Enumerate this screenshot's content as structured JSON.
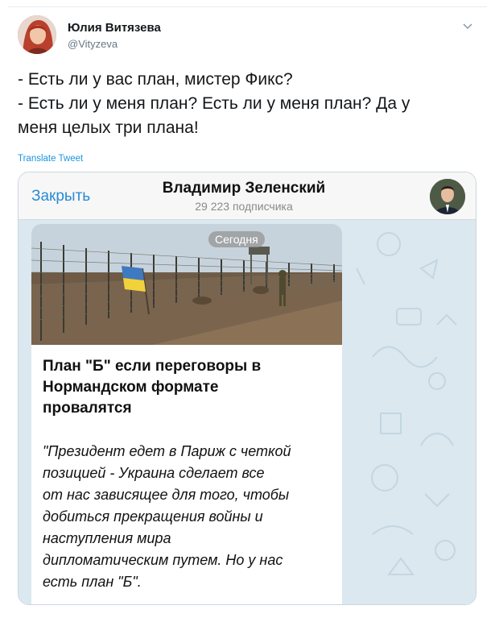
{
  "tweet": {
    "author_name": "Юлия Витязева",
    "author_handle": "@Vityzeva",
    "text": "- Есть ли у вас план, мистер Фикс?\n- Есть ли у меня план? Есть ли у меня план? Да у\nменя целых три плана!",
    "translate_label": "Translate Tweet",
    "colors": {
      "link": "#1b95e0",
      "text": "#14171a",
      "secondary": "#657786"
    }
  },
  "telegram": {
    "close_label": "Закрыть",
    "channel_name": "Владимир Зеленский",
    "subscribers": "29 223 подписчика",
    "date_badge": "Сегодня",
    "post_title": "План \"Б\" если переговоры в\nНормандском формате\nпровалятся",
    "post_quote": "\"Президент едет в Париж с четкой\nпозицией - Украина сделает все\nот нас зависящее для того, чтобы\nдобиться прекращения войны и\nнаступления мира\nдипломатическим путем. Но у нас\nесть план \"Б\".",
    "colors": {
      "link": "#2a8ad4",
      "chat_background": "#dbe8f0"
    }
  }
}
